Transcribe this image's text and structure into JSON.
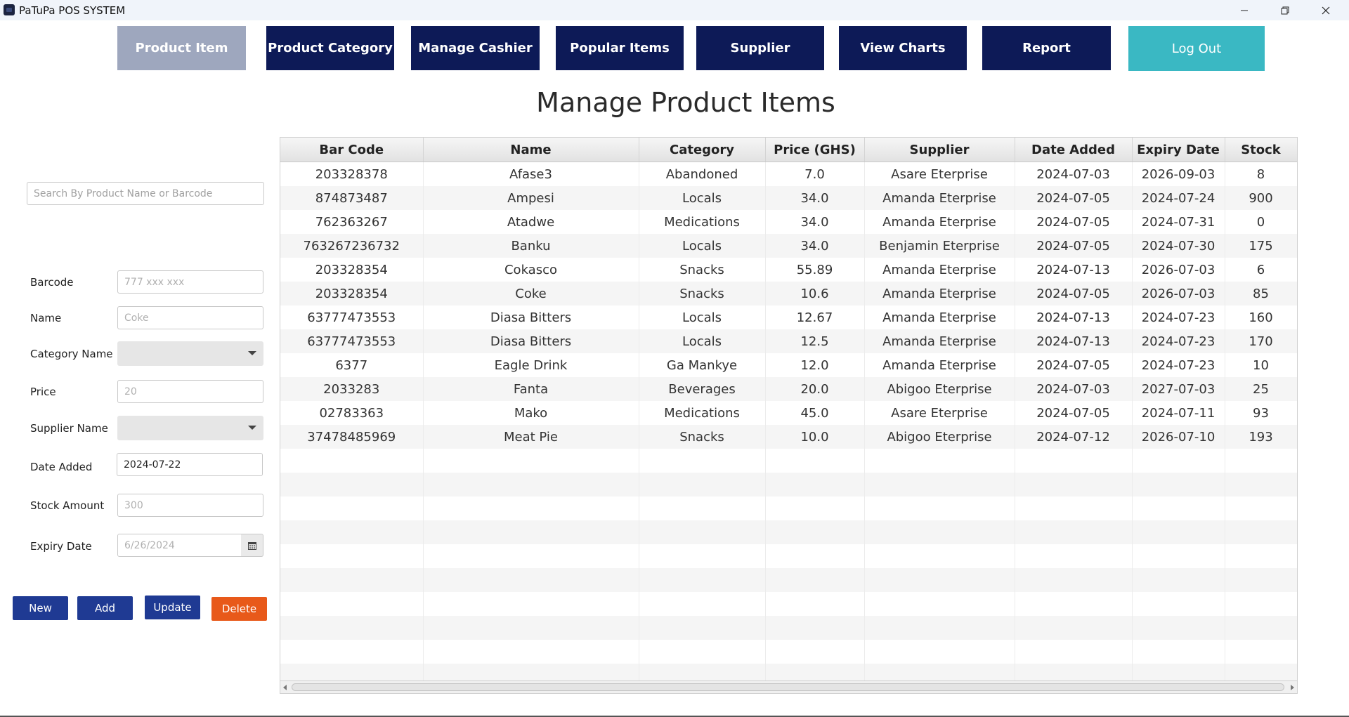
{
  "window": {
    "title": "PaTuPa POS SYSTEM",
    "minimize_icon": "minimize-icon",
    "maximize_icon": "restore-icon",
    "close_icon": "close-icon"
  },
  "nav": {
    "items": [
      {
        "label": "Product Item",
        "active": true
      },
      {
        "label": "Product Category"
      },
      {
        "label": "Manage Cashier"
      },
      {
        "label": "Popular Items"
      },
      {
        "label": "Supplier"
      },
      {
        "label": "View Charts"
      },
      {
        "label": "Report"
      }
    ],
    "logout_label": "Log Out",
    "colors": {
      "active": "#9ea7be",
      "default": "#0d1a57",
      "logout": "#3ab8c3"
    }
  },
  "page": {
    "title": "Manage Product Items"
  },
  "search": {
    "placeholder": "Search By Product Name or Barcode"
  },
  "form": {
    "barcode_label": "Barcode",
    "barcode_placeholder": "777 xxx xxx",
    "name_label": "Name",
    "name_placeholder": "Coke",
    "category_label": "Category Name",
    "price_label": "Price",
    "price_placeholder": "20",
    "supplier_label": "Supplier Name",
    "date_added_label": "Date Added",
    "date_added_value": "2024-07-22",
    "stock_label": "Stock Amount",
    "stock_placeholder": "300",
    "expiry_label": "Expiry Date",
    "expiry_placeholder": "6/26/2024"
  },
  "actions": {
    "new_label": "New",
    "add_label": "Add",
    "update_label": "Update",
    "delete_label": "Delete",
    "colors": {
      "primary": "#1f3a93",
      "delete": "#e8591a"
    }
  },
  "table": {
    "columns": [
      "Bar Code",
      "Name",
      "Category",
      "Price (GHS)",
      "Supplier",
      "Date Added",
      "Expiry Date",
      "Stock"
    ],
    "rows": [
      [
        "203328378",
        "Afase3",
        "Abandoned",
        "7.0",
        "Asare Eterprise",
        "2024-07-03",
        "2026-09-03",
        "8"
      ],
      [
        "874873487",
        "Ampesi",
        "Locals",
        "34.0",
        "Amanda Eterprise",
        "2024-07-05",
        "2024-07-24",
        "900"
      ],
      [
        "762363267",
        "Atadwe",
        "Medications",
        "34.0",
        "Amanda Eterprise",
        "2024-07-05",
        "2024-07-31",
        "0"
      ],
      [
        "763267236732",
        "Banku",
        "Locals",
        "34.0",
        "Benjamin Eterprise",
        "2024-07-05",
        "2024-07-30",
        "175"
      ],
      [
        "203328354",
        "Cokasco",
        "Snacks",
        "55.89",
        "Amanda Eterprise",
        "2024-07-13",
        "2026-07-03",
        "6"
      ],
      [
        "203328354",
        "Coke",
        "Snacks",
        "10.6",
        "Amanda Eterprise",
        "2024-07-05",
        "2026-07-03",
        "85"
      ],
      [
        "63777473553",
        "Diasa Bitters",
        "Locals",
        "12.67",
        "Amanda Eterprise",
        "2024-07-13",
        "2024-07-23",
        "160"
      ],
      [
        "63777473553",
        "Diasa Bitters",
        "Locals",
        "12.5",
        "Amanda Eterprise",
        "2024-07-13",
        "2024-07-23",
        "170"
      ],
      [
        "6377",
        "Eagle Drink",
        "Ga Mankye",
        "12.0",
        "Amanda Eterprise",
        "2024-07-05",
        "2024-07-23",
        "10"
      ],
      [
        "2033283",
        "Fanta",
        "Beverages",
        "20.0",
        "Abigoo Eterprise",
        "2024-07-03",
        "2027-07-03",
        "25"
      ],
      [
        "02783363",
        "Mako",
        "Medications",
        "45.0",
        "Asare Eterprise",
        "2024-07-05",
        "2024-07-11",
        "93"
      ],
      [
        "37478485969",
        "Meat Pie",
        "Snacks",
        "10.0",
        "Abigoo Eterprise",
        "2024-07-12",
        "2026-07-10",
        "193"
      ]
    ],
    "empty_rows": 10
  }
}
